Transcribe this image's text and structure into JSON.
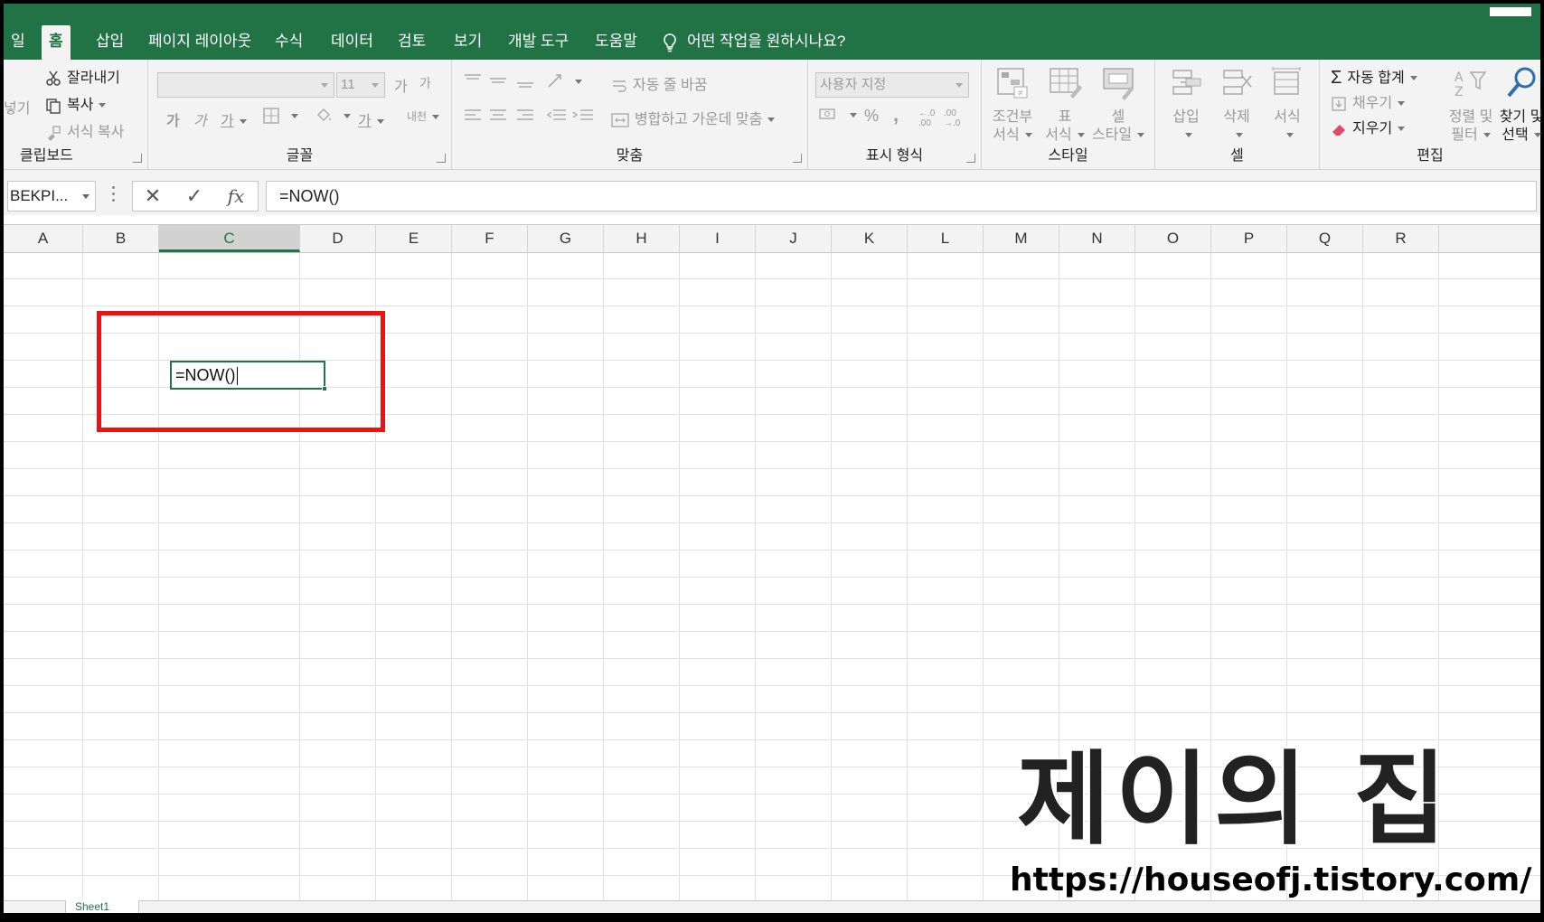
{
  "ribbon_tabs": {
    "file_partial": "일",
    "home": "홈",
    "insert": "삽입",
    "page_layout": "페이지 레이아웃",
    "formulas": "수식",
    "data": "데이터",
    "review": "검토",
    "view": "보기",
    "developer": "개발 도구",
    "help": "도움말",
    "tell_me": "어떤 작업을 원하시나요?"
  },
  "clipboard": {
    "paste_partial": "붙여넣기",
    "paste_visible": "넣기",
    "cut": "잘라내기",
    "copy": "복사",
    "format_painter": "서식 복사",
    "label": "클립보드"
  },
  "font": {
    "font_name": "",
    "font_size": "11",
    "grow": "가",
    "shrink": "가",
    "bold": "가",
    "italic": "가",
    "underline": "가",
    "font_color": "가",
    "phonetic": "내천",
    "label": "글꼴"
  },
  "alignment": {
    "wrap_text": "자동 줄 바꿈",
    "merge_center": "병합하고 가운데 맞춤",
    "label": "맞춤"
  },
  "number": {
    "format": "사용자 지정",
    "percent": "%",
    "comma": ",",
    "inc_decimal": "←.0 .00",
    "dec_decimal": ".00 →.0",
    "label": "표시 형식"
  },
  "styles": {
    "conditional_line1": "조건부",
    "conditional_line2": "서식",
    "table_line1": "표",
    "table_line2": "서식",
    "cell_line1": "셀",
    "cell_line2": "스타일",
    "label": "스타일"
  },
  "cells": {
    "insert": "삽입",
    "delete": "삭제",
    "format": "서식",
    "label": "셀"
  },
  "editing": {
    "autosum": "자동 합계",
    "fill": "채우기",
    "clear": "지우기",
    "sort_line1": "정렬 및",
    "sort_line2": "필터",
    "find_line1": "찾기 및",
    "find_line2": "선택",
    "label": "편집"
  },
  "formula_bar": {
    "name_box": "BEKPI...",
    "cancel": "✕",
    "enter": "✓",
    "fx": "fx",
    "content": "=NOW()"
  },
  "columns": [
    "A",
    "B",
    "C",
    "D",
    "E",
    "F",
    "G",
    "H",
    "I",
    "J",
    "K",
    "L",
    "M",
    "N",
    "O",
    "P",
    "Q",
    "R"
  ],
  "selected_column": "C",
  "active_cell": {
    "address": "C5",
    "value": "=NOW()"
  },
  "sheet_tab": "Sheet1",
  "watermark": {
    "title": "제이의 집",
    "url": "https://houseofj.tistory.com/"
  },
  "colors": {
    "excel_green": "#217346",
    "highlight_red": "#ee1111"
  }
}
